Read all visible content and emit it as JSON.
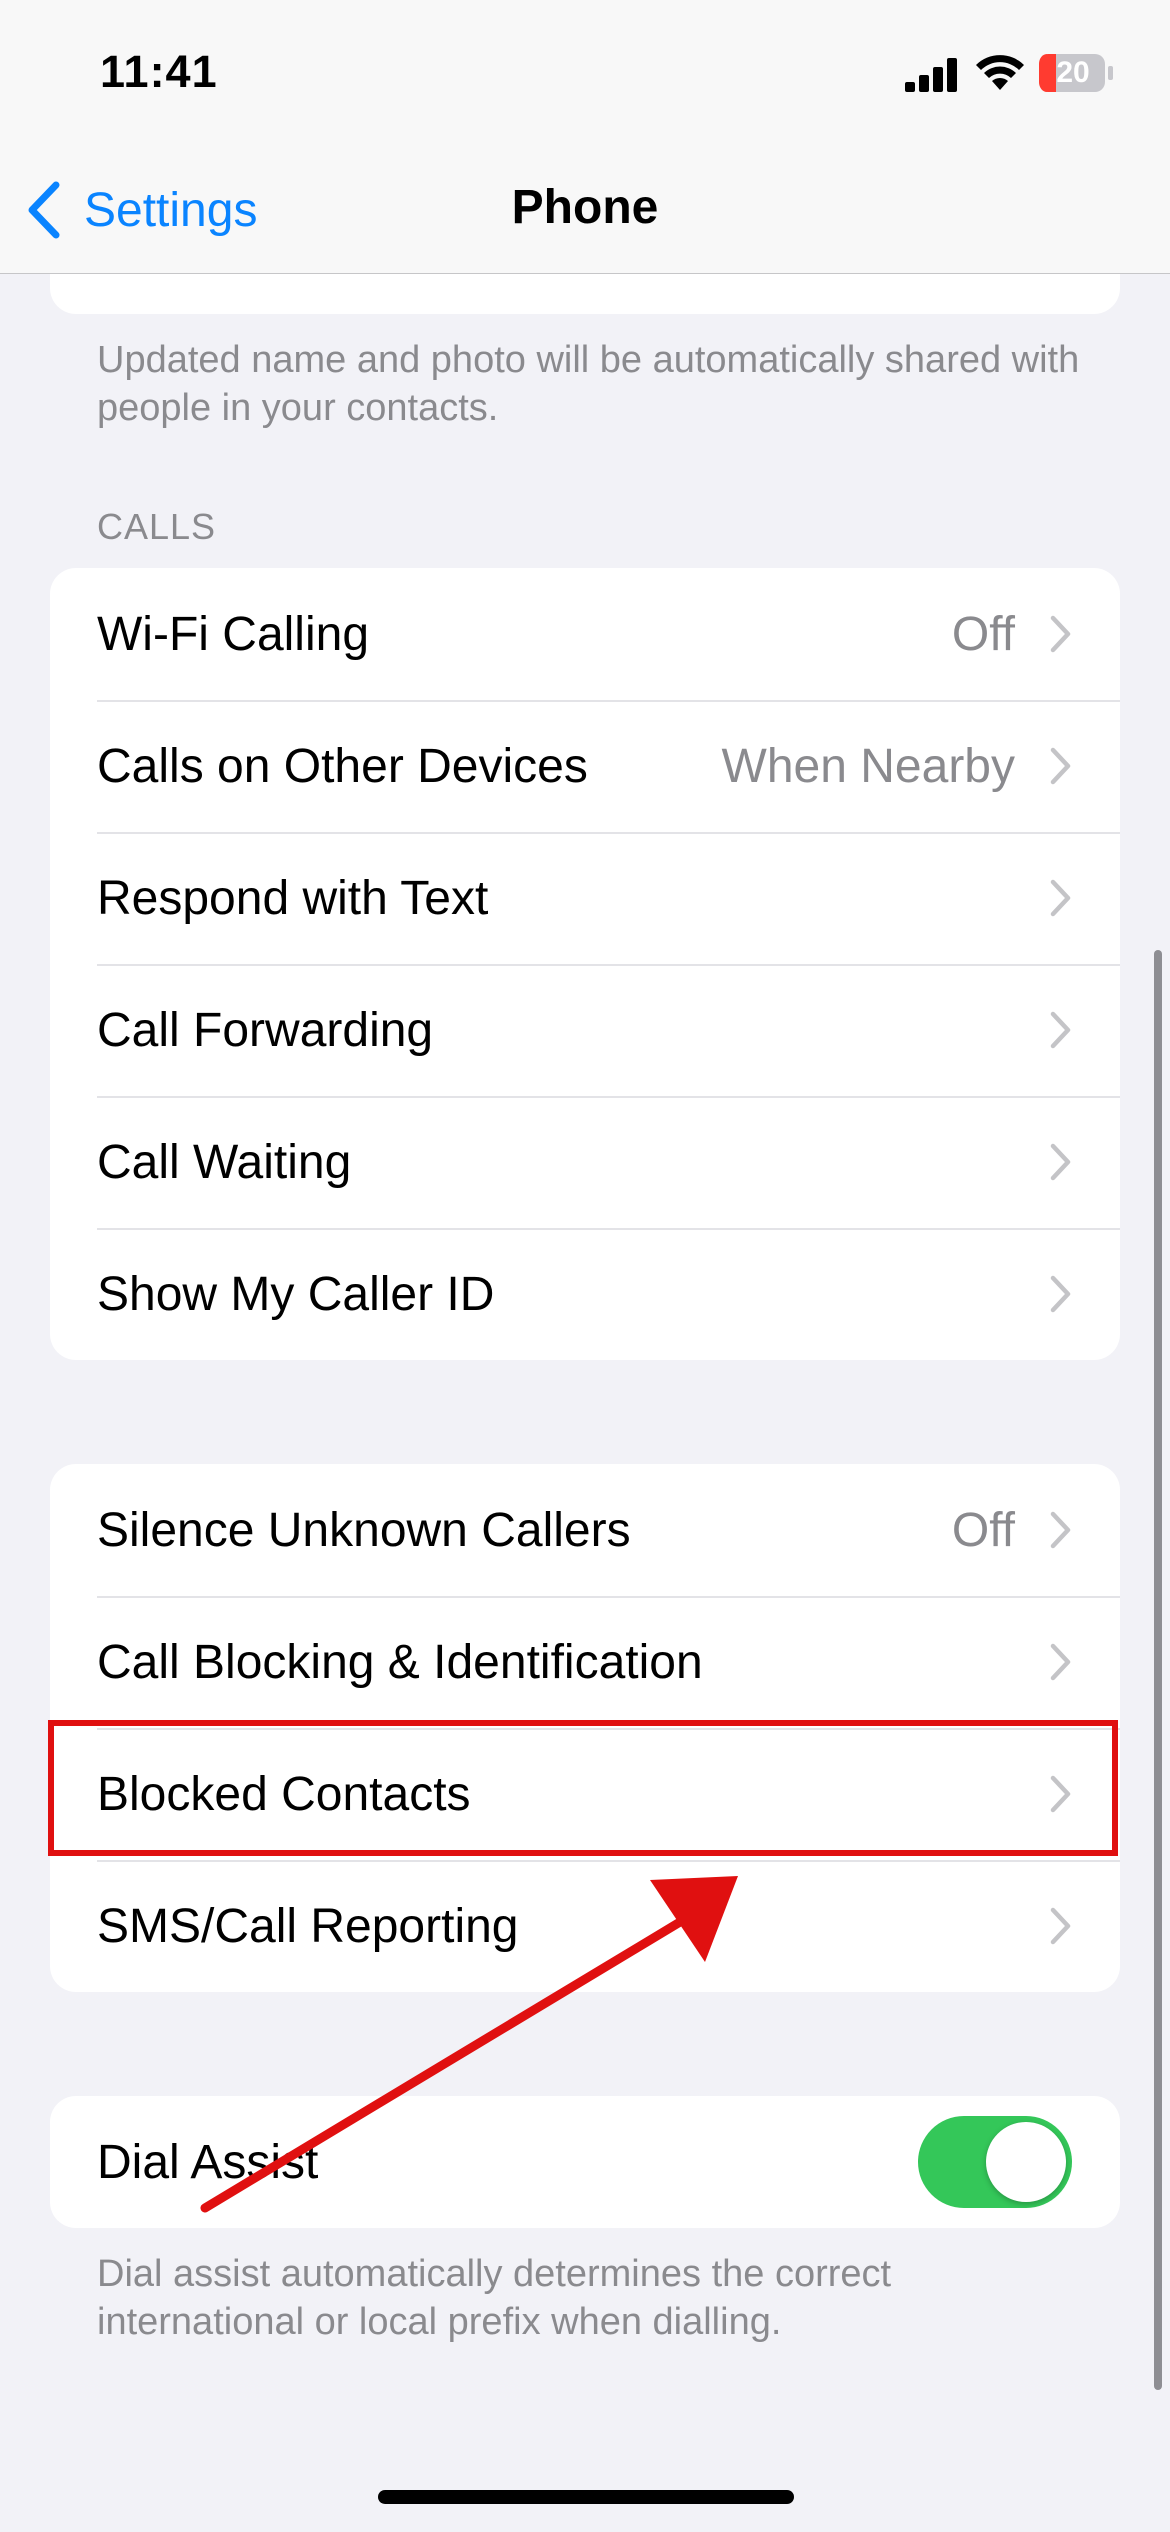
{
  "status_bar": {
    "time": "11:41",
    "battery_level": "20",
    "battery_color": "#ff3b30"
  },
  "nav": {
    "back_label": "Settings",
    "title": "Phone"
  },
  "shared_name_footnote": "Updated name and photo will be automatically shared with people in your contacts.",
  "calls_section": {
    "header": "CALLS",
    "rows": [
      {
        "label": "Wi-Fi Calling",
        "value": "Off"
      },
      {
        "label": "Calls on Other Devices",
        "value": "When Nearby"
      },
      {
        "label": "Respond with Text",
        "value": ""
      },
      {
        "label": "Call Forwarding",
        "value": ""
      },
      {
        "label": "Call Waiting",
        "value": ""
      },
      {
        "label": "Show My Caller ID",
        "value": ""
      }
    ]
  },
  "blocking_section": {
    "rows": [
      {
        "label": "Silence Unknown Callers",
        "value": "Off"
      },
      {
        "label": "Call Blocking & Identification",
        "value": ""
      },
      {
        "label": "Blocked Contacts",
        "value": ""
      },
      {
        "label": "SMS/Call Reporting",
        "value": ""
      }
    ]
  },
  "dial_assist": {
    "label": "Dial Assist",
    "enabled": true,
    "footnote": "Dial assist automatically determines the correct international or local prefix when dialling."
  },
  "colors": {
    "accent": "#0a84ff",
    "toggle_on": "#34c759",
    "annotation": "#e01010"
  }
}
